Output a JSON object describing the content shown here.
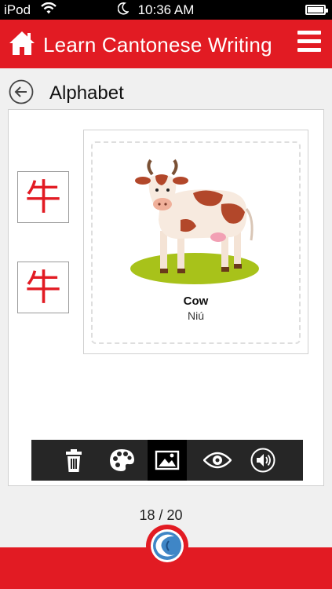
{
  "status_bar": {
    "carrier": "iPod",
    "time": "10:36 AM",
    "icons": [
      "wifi-icon",
      "moon-icon",
      "battery-icon"
    ]
  },
  "header": {
    "title": "Learn Cantonese Writing",
    "icons": [
      "home-icon",
      "menu-icon"
    ]
  },
  "section": {
    "title": "Alphabet",
    "back_icon": "back-arrow-icon"
  },
  "characters": [
    "牛",
    "牛"
  ],
  "card": {
    "word": "Cow",
    "pinyin": "Niú",
    "image": "cow-illustration"
  },
  "toolbar": {
    "tools": [
      "trash-icon",
      "palette-icon",
      "image-icon",
      "eye-icon",
      "speaker-icon"
    ],
    "active": "image-icon"
  },
  "pagination": {
    "current": 18,
    "total": 20,
    "label": "18 / 20"
  },
  "colors": {
    "accent": "#e21b23",
    "toolbar": "#262626",
    "character": "#e21b23"
  }
}
